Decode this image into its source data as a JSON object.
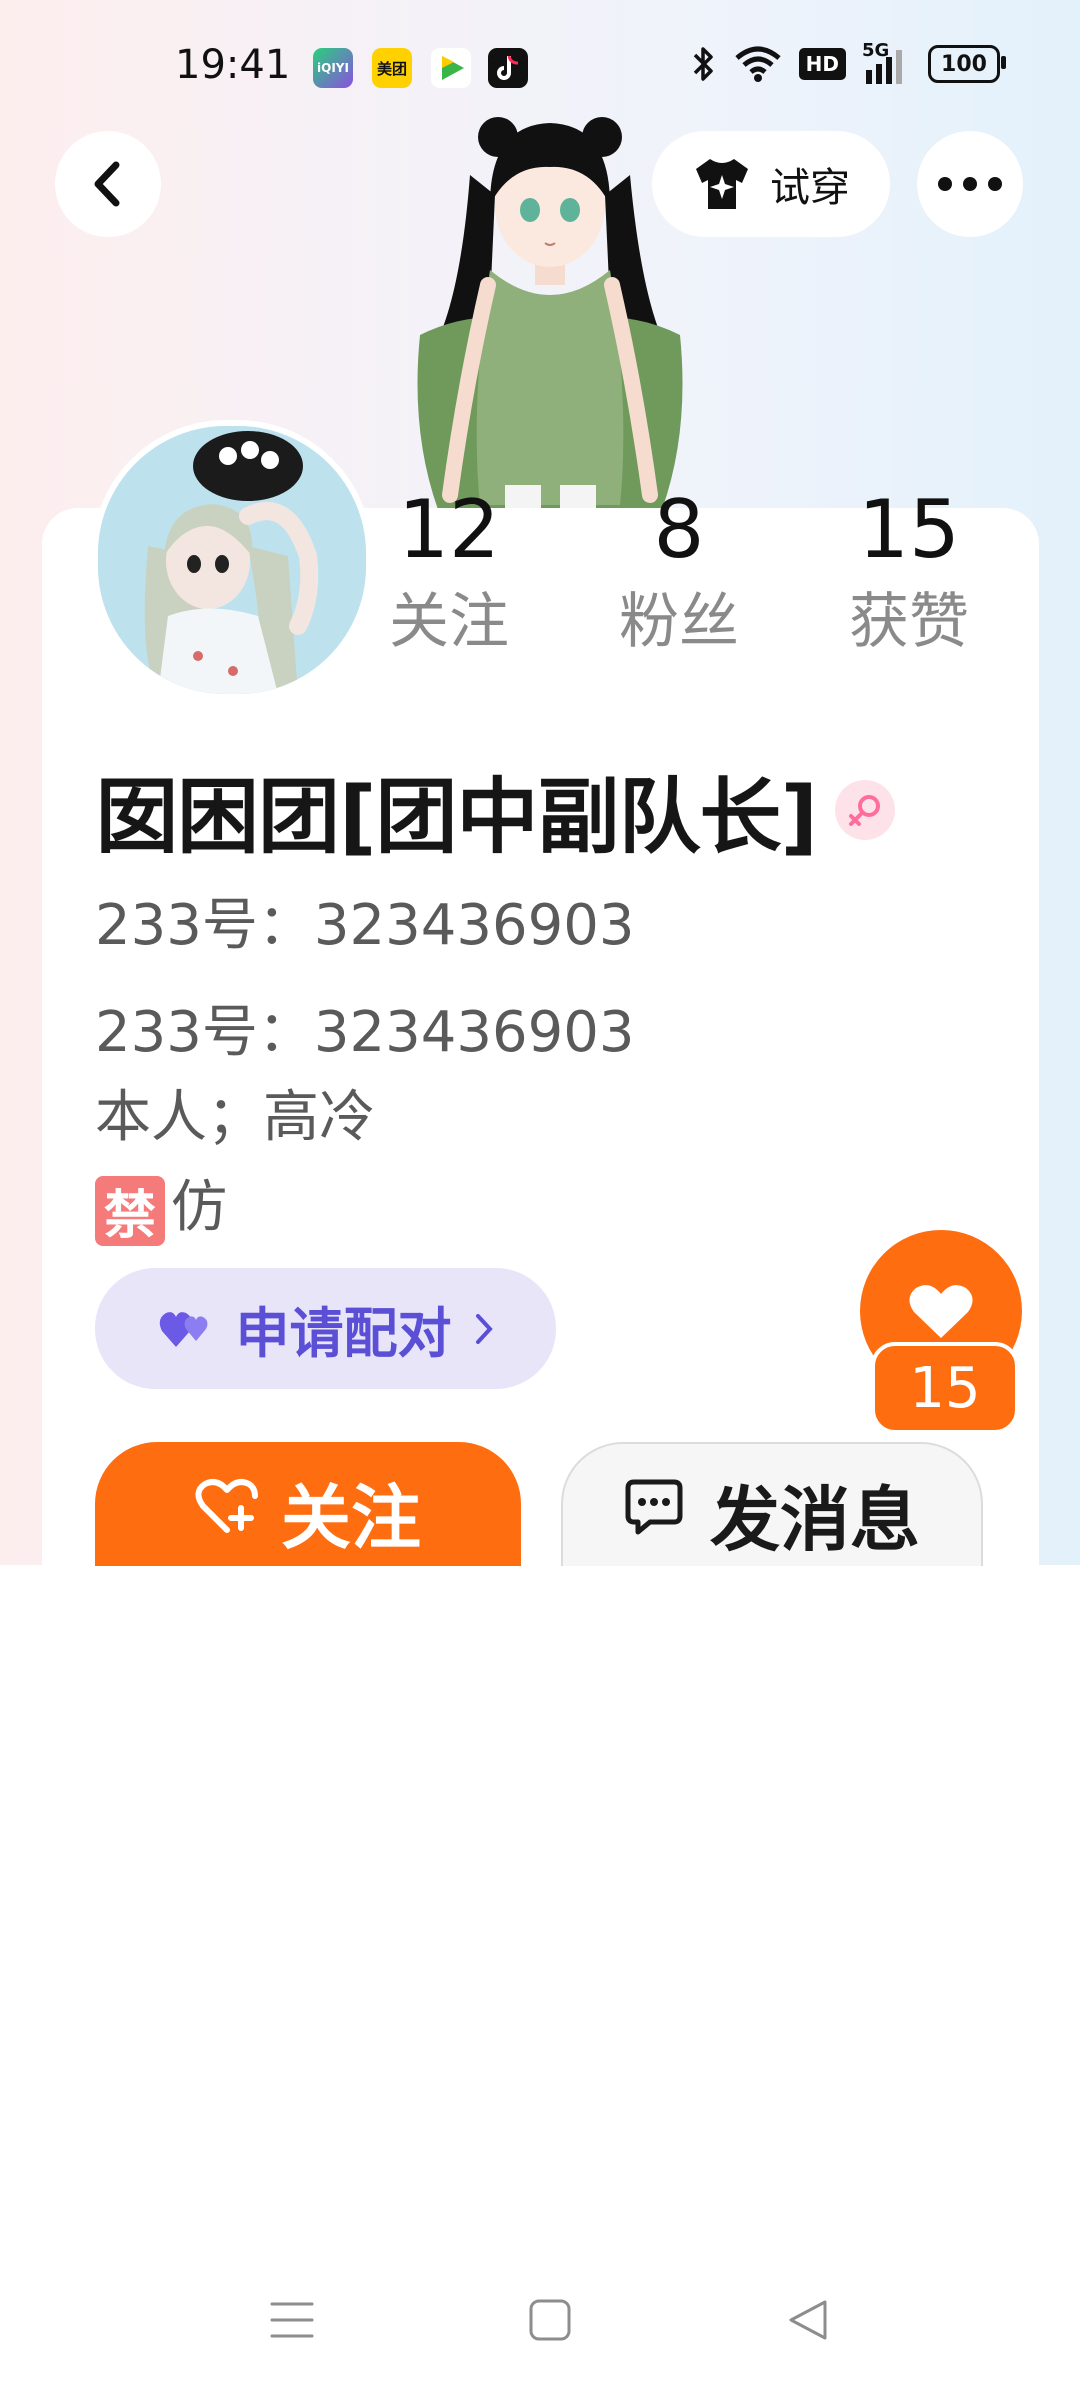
{
  "status_bar": {
    "time": "19:41",
    "apps": [
      {
        "name": "iqiyi-icon",
        "label": "iQIYI",
        "color": "#2bc96a"
      },
      {
        "name": "meituan-icon",
        "label": "美团",
        "color": "#ffd100"
      },
      {
        "name": "video-app-icon",
        "label": "",
        "color": "#3ab54a"
      },
      {
        "name": "douyin-icon",
        "label": "",
        "color": "#111111"
      }
    ],
    "hd_label": "HD",
    "network_label": "5G",
    "battery": "100"
  },
  "header": {
    "try_on_label": "试穿"
  },
  "stats": [
    {
      "num": "12",
      "label": "关注"
    },
    {
      "num": "8",
      "label": "粉丝"
    },
    {
      "num": "15",
      "label": "获赞"
    }
  ],
  "profile": {
    "name": "囡困团[团中副队长]",
    "info_lines": [
      "233号：323436903",
      "233号：323436903",
      "本人；高冷"
    ],
    "ban_char": "禁",
    "ban_rest": "仿"
  },
  "pair_button": {
    "label": "申请配对"
  },
  "like": {
    "count": "15"
  },
  "actions": {
    "follow_label": "关注",
    "message_label": "发消息"
  },
  "colors": {
    "accent": "#ff6d11",
    "pair_text": "#5b4fd6",
    "pair_bg": "#e8e5f9"
  }
}
